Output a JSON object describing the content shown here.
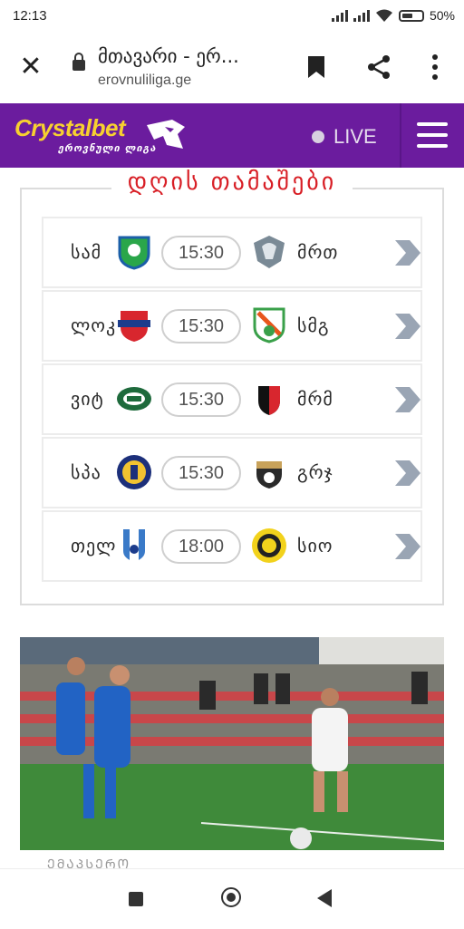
{
  "status_bar": {
    "time": "12:13",
    "battery": "50%"
  },
  "browser": {
    "page_title": "მთავარი - ერ...",
    "url": "erovnuliliga.ge"
  },
  "header": {
    "brand": "Crystalbet",
    "brand_sub": "ეროვნული ლიგა",
    "live_label": "LIVE",
    "brand_color": "#6b1c9e",
    "logo_color": "#f7d030"
  },
  "games": {
    "title": "დღის თამაშები",
    "matches": [
      {
        "home": "სამ",
        "time": "15:30",
        "away": "მრთ"
      },
      {
        "home": "ლოკ",
        "time": "15:30",
        "away": "სმგ"
      },
      {
        "home": "ვიტ",
        "time": "15:30",
        "away": "მრმ"
      },
      {
        "home": "სპა",
        "time": "15:30",
        "away": "გრჯ"
      },
      {
        "home": "თელ",
        "time": "18:00",
        "away": "სიო"
      }
    ]
  },
  "photo": {
    "caption": "ᲔᲛᲐᲞᲡᲔᲠᲝ"
  }
}
